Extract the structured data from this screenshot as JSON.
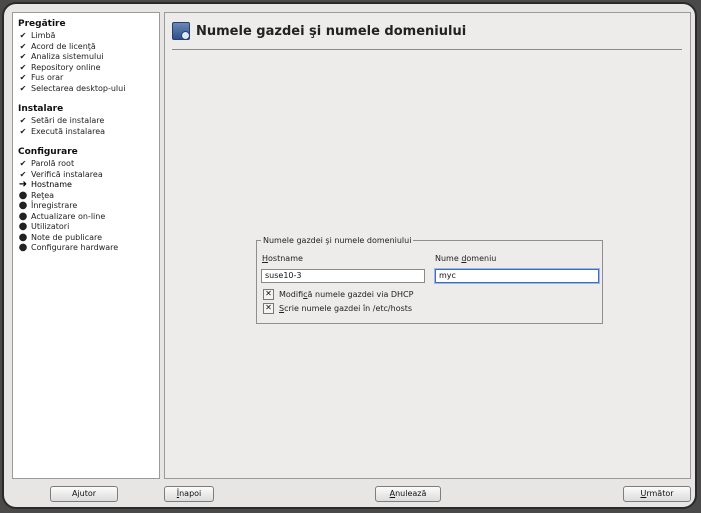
{
  "sidebar": {
    "sections": [
      {
        "title": "Pregătire",
        "items": [
          {
            "label": "Limbă",
            "state": "check"
          },
          {
            "label": "Acord de licenţă",
            "state": "check"
          },
          {
            "label": "Analiza sistemului",
            "state": "check"
          },
          {
            "label": "Repository online",
            "state": "check"
          },
          {
            "label": "Fus orar",
            "state": "check"
          },
          {
            "label": "Selectarea desktop-ului",
            "state": "check"
          }
        ]
      },
      {
        "title": "Instalare",
        "items": [
          {
            "label": "Setări de instalare",
            "state": "check"
          },
          {
            "label": "Execută instalarea",
            "state": "check"
          }
        ]
      },
      {
        "title": "Configurare",
        "items": [
          {
            "label": "Parolă root",
            "state": "check"
          },
          {
            "label": "Verifică instalarea",
            "state": "check"
          },
          {
            "label": "Hostname",
            "state": "current"
          },
          {
            "label": "Reţea",
            "state": "pending"
          },
          {
            "label": "Înregistrare",
            "state": "pending"
          },
          {
            "label": "Actualizare on-line",
            "state": "pending"
          },
          {
            "label": "Utilizatori",
            "state": "pending"
          },
          {
            "label": "Note de publicare",
            "state": "pending"
          },
          {
            "label": "Configurare hardware",
            "state": "pending"
          }
        ]
      }
    ]
  },
  "header": {
    "title": "Numele gazdei şi numele domeniului",
    "icon": "network-host-icon"
  },
  "form": {
    "group_label": "Numele gazdei şi numele domeniului",
    "hostname": {
      "label_pre": "",
      "label_key": "H",
      "label_post": "ostname",
      "value": "suse10-3"
    },
    "domain": {
      "label_pre": "Nume ",
      "label_key": "d",
      "label_post": "omeniu",
      "value": "myc"
    },
    "dhcp_checkbox": {
      "label_pre": "Modifi",
      "label_key": "c",
      "label_post": "ă numele gazdei via DHCP",
      "checked": true
    },
    "hosts_checkbox": {
      "label_pre": "",
      "label_key": "S",
      "label_post": "crie numele gazdei în /etc/hosts",
      "checked": true
    }
  },
  "buttons": {
    "help": "Ajutor",
    "back_key": "Î",
    "back_rest": "napoi",
    "abort_key": "A",
    "abort_rest": "nulează",
    "next_key": "U",
    "next_rest": "rmător"
  },
  "marks": {
    "check": "✔",
    "current": "➜",
    "pending": "●",
    "checked_box": "✕"
  }
}
